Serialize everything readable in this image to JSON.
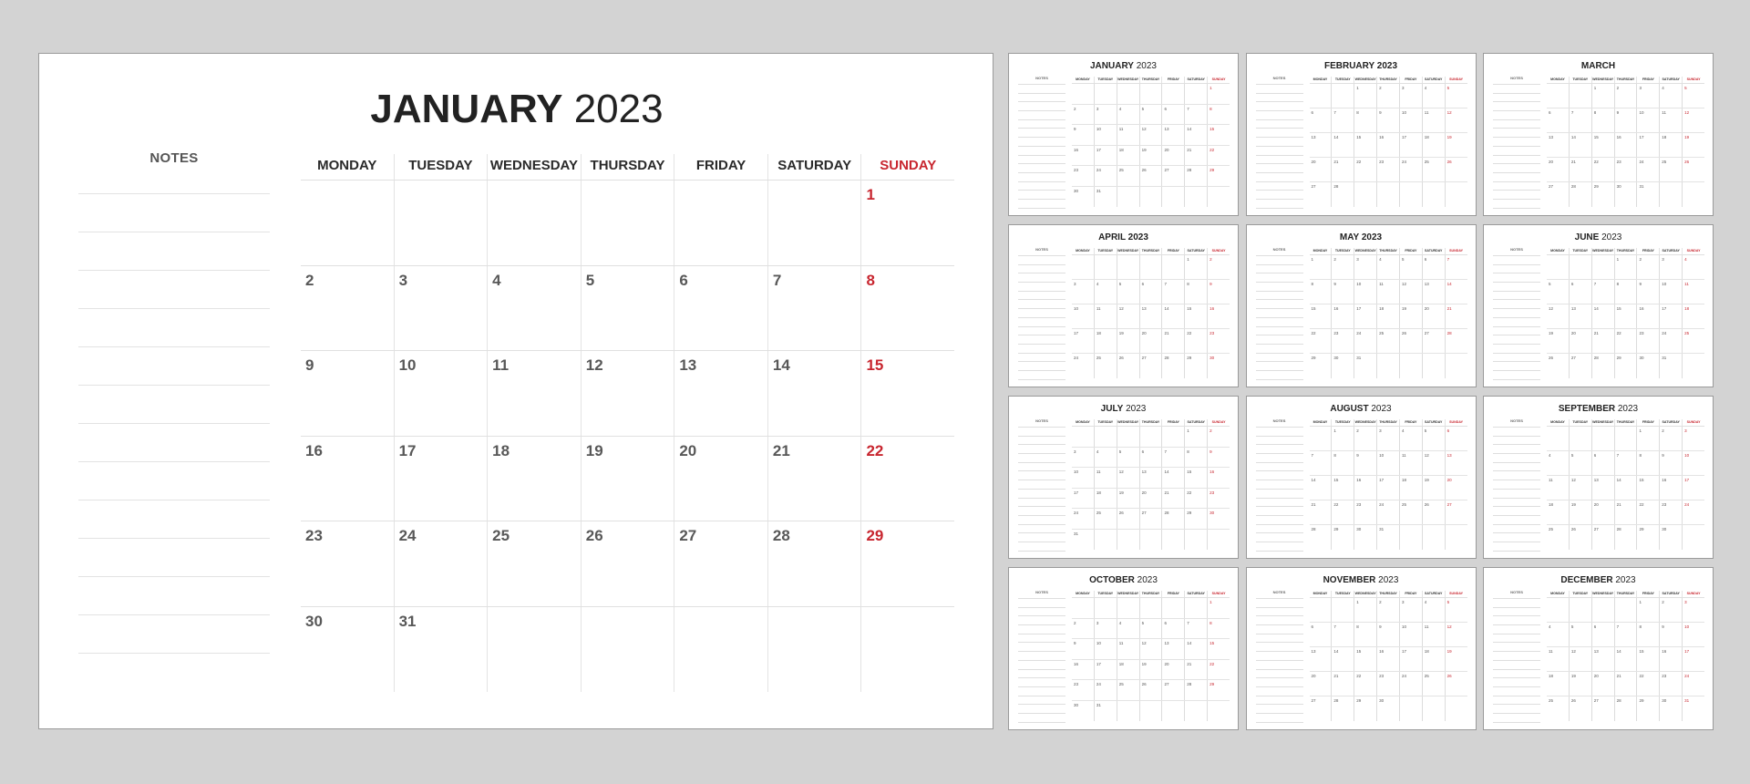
{
  "colors": {
    "background": "#d3d3d3",
    "sunday": "#c8262f",
    "text": "#222222",
    "date": "#585858"
  },
  "main_calendar": {
    "month": "JANUARY",
    "year": "2023",
    "notes_label": "NOTES",
    "notes_line_count": 13,
    "weekdays": [
      "MONDAY",
      "TUESDAY",
      "WEDNESDAY",
      "THURSDAY",
      "FRIDAY",
      "SATURDAY",
      "SUNDAY"
    ],
    "weeks": [
      [
        "",
        "",
        "",
        "",
        "",
        "",
        "1"
      ],
      [
        "2",
        "3",
        "4",
        "5",
        "6",
        "7",
        "8"
      ],
      [
        "9",
        "10",
        "11",
        "12",
        "13",
        "14",
        "15"
      ],
      [
        "16",
        "17",
        "18",
        "19",
        "20",
        "21",
        "22"
      ],
      [
        "23",
        "24",
        "25",
        "26",
        "27",
        "28",
        "29"
      ],
      [
        "30",
        "31",
        "",
        "",
        "",
        "",
        ""
      ]
    ]
  },
  "mini_calendars": {
    "notes_label": "NOTES",
    "weekdays": [
      "MONDAY",
      "TUESDAY",
      "WEDNESDAY",
      "THURSDAY",
      "FRIDAY",
      "SATURDAY",
      "SUNDAY"
    ],
    "months": [
      {
        "month": "JANUARY",
        "year": "2023",
        "weeks": [
          [
            "",
            "",
            "",
            "",
            "",
            "",
            "1"
          ],
          [
            "2",
            "3",
            "4",
            "5",
            "6",
            "7",
            "8"
          ],
          [
            "9",
            "10",
            "11",
            "12",
            "13",
            "14",
            "15"
          ],
          [
            "16",
            "17",
            "18",
            "19",
            "20",
            "21",
            "22"
          ],
          [
            "23",
            "24",
            "25",
            "26",
            "27",
            "28",
            "29"
          ],
          [
            "30",
            "31",
            "",
            "",
            "",
            "",
            ""
          ]
        ]
      },
      {
        "month": "FEBRUARY",
        "year": "2023",
        "year_bold": true,
        "weeks": [
          [
            "",
            "",
            "1",
            "2",
            "3",
            "4",
            "5"
          ],
          [
            "6",
            "7",
            "8",
            "9",
            "10",
            "11",
            "12"
          ],
          [
            "13",
            "14",
            "15",
            "16",
            "17",
            "18",
            "19"
          ],
          [
            "20",
            "21",
            "22",
            "23",
            "24",
            "25",
            "26"
          ],
          [
            "27",
            "28",
            "",
            "",
            "",
            "",
            ""
          ]
        ]
      },
      {
        "month": "MARCH",
        "year": "",
        "weeks": [
          [
            "",
            "",
            "1",
            "2",
            "3",
            "4",
            "5"
          ],
          [
            "6",
            "7",
            "8",
            "9",
            "10",
            "11",
            "12"
          ],
          [
            "13",
            "14",
            "15",
            "16",
            "17",
            "18",
            "19"
          ],
          [
            "20",
            "21",
            "22",
            "23",
            "24",
            "25",
            "26"
          ],
          [
            "27",
            "28",
            "29",
            "30",
            "31",
            "",
            ""
          ]
        ]
      },
      {
        "month": "APRIL",
        "year": "2023",
        "year_bold": true,
        "weeks": [
          [
            "",
            "",
            "",
            "",
            "",
            "1",
            "2"
          ],
          [
            "3",
            "4",
            "5",
            "6",
            "7",
            "8",
            "9"
          ],
          [
            "10",
            "11",
            "12",
            "13",
            "14",
            "15",
            "16"
          ],
          [
            "17",
            "18",
            "19",
            "20",
            "21",
            "22",
            "23"
          ],
          [
            "24",
            "25",
            "26",
            "27",
            "28",
            "29",
            "30"
          ]
        ]
      },
      {
        "month": "MAY",
        "year": "2023",
        "year_bold": true,
        "weeks": [
          [
            "1",
            "2",
            "3",
            "4",
            "5",
            "6",
            "7"
          ],
          [
            "8",
            "9",
            "10",
            "11",
            "12",
            "13",
            "14"
          ],
          [
            "15",
            "16",
            "17",
            "18",
            "19",
            "20",
            "21"
          ],
          [
            "22",
            "23",
            "24",
            "25",
            "26",
            "27",
            "28"
          ],
          [
            "29",
            "30",
            "31",
            "",
            "",
            "",
            ""
          ]
        ]
      },
      {
        "month": "JUNE",
        "year": "2023",
        "weeks": [
          [
            "",
            "",
            "",
            "1",
            "2",
            "3",
            "4"
          ],
          [
            "5",
            "6",
            "7",
            "8",
            "9",
            "10",
            "11"
          ],
          [
            "12",
            "13",
            "14",
            "15",
            "16",
            "17",
            "18"
          ],
          [
            "19",
            "20",
            "21",
            "22",
            "23",
            "24",
            "25"
          ],
          [
            "26",
            "27",
            "28",
            "29",
            "30",
            "31",
            ""
          ]
        ]
      },
      {
        "month": "JULY",
        "year": "2023",
        "weeks": [
          [
            "",
            "",
            "",
            "",
            "",
            "1",
            "2"
          ],
          [
            "3",
            "4",
            "5",
            "6",
            "7",
            "8",
            "9"
          ],
          [
            "10",
            "11",
            "12",
            "13",
            "14",
            "15",
            "16"
          ],
          [
            "17",
            "18",
            "19",
            "20",
            "21",
            "22",
            "23"
          ],
          [
            "24",
            "25",
            "26",
            "27",
            "28",
            "29",
            "30"
          ],
          [
            "31",
            "",
            "",
            "",
            "",
            "",
            ""
          ]
        ]
      },
      {
        "month": "AUGUST",
        "year": "2023",
        "weeks": [
          [
            "",
            "1",
            "2",
            "3",
            "4",
            "5",
            "6"
          ],
          [
            "7",
            "8",
            "9",
            "10",
            "11",
            "12",
            "13"
          ],
          [
            "14",
            "15",
            "16",
            "17",
            "18",
            "19",
            "20"
          ],
          [
            "21",
            "22",
            "23",
            "24",
            "25",
            "26",
            "27"
          ],
          [
            "28",
            "29",
            "30",
            "31",
            "",
            "",
            ""
          ]
        ]
      },
      {
        "month": "SEPTEMBER",
        "year": "2023",
        "weeks": [
          [
            "",
            "",
            "",
            "",
            "1",
            "2",
            "3"
          ],
          [
            "4",
            "5",
            "6",
            "7",
            "8",
            "9",
            "10"
          ],
          [
            "11",
            "12",
            "13",
            "14",
            "15",
            "16",
            "17"
          ],
          [
            "18",
            "19",
            "20",
            "21",
            "22",
            "23",
            "24"
          ],
          [
            "25",
            "26",
            "27",
            "28",
            "29",
            "30",
            ""
          ]
        ]
      },
      {
        "month": "OCTOBER",
        "year": "2023",
        "weeks": [
          [
            "",
            "",
            "",
            "",
            "",
            "",
            "1"
          ],
          [
            "2",
            "3",
            "4",
            "5",
            "6",
            "7",
            "8"
          ],
          [
            "9",
            "10",
            "11",
            "12",
            "13",
            "14",
            "15"
          ],
          [
            "16",
            "17",
            "18",
            "19",
            "20",
            "21",
            "22"
          ],
          [
            "23",
            "24",
            "25",
            "26",
            "27",
            "28",
            "29"
          ],
          [
            "30",
            "31",
            "",
            "",
            "",
            "",
            ""
          ]
        ]
      },
      {
        "month": "NOVEMBER",
        "year": "2023",
        "weeks": [
          [
            "",
            "",
            "1",
            "2",
            "3",
            "4",
            "5"
          ],
          [
            "6",
            "7",
            "8",
            "9",
            "10",
            "11",
            "12"
          ],
          [
            "13",
            "14",
            "15",
            "16",
            "17",
            "18",
            "19"
          ],
          [
            "20",
            "21",
            "22",
            "23",
            "24",
            "25",
            "26"
          ],
          [
            "27",
            "28",
            "29",
            "30",
            "",
            "",
            ""
          ]
        ]
      },
      {
        "month": "DECEMBER",
        "year": "2023",
        "weeks": [
          [
            "",
            "",
            "",
            "",
            "1",
            "2",
            "3"
          ],
          [
            "4",
            "5",
            "6",
            "7",
            "8",
            "9",
            "10"
          ],
          [
            "11",
            "12",
            "13",
            "14",
            "15",
            "16",
            "17"
          ],
          [
            "18",
            "19",
            "20",
            "21",
            "22",
            "23",
            "24"
          ],
          [
            "25",
            "26",
            "27",
            "28",
            "29",
            "30",
            "31"
          ]
        ]
      }
    ]
  }
}
